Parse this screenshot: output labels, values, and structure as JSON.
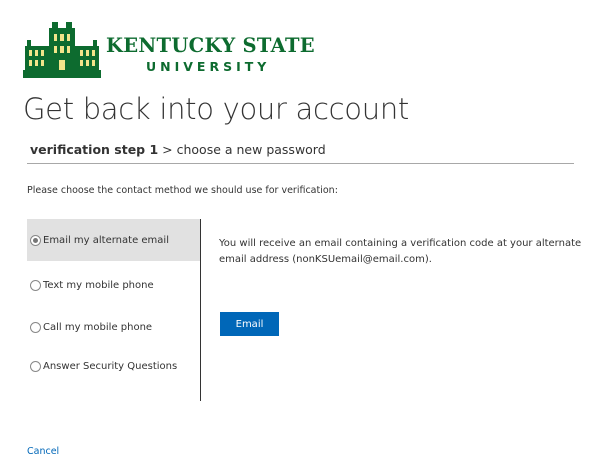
{
  "logo": {
    "line1": "KENTUCKY STATE",
    "line2": "UNIVERSITY"
  },
  "page": {
    "title": "Get back into your account"
  },
  "steps": {
    "current": "verification step 1",
    "separator": " > ",
    "next": "choose a new password"
  },
  "instructions": "Please choose the contact method we should use for verification:",
  "methods": [
    {
      "label": "Email my alternate email",
      "selected": true
    },
    {
      "label": "Text my mobile phone",
      "selected": false
    },
    {
      "label": "Call my mobile phone",
      "selected": false
    },
    {
      "label": "Answer Security Questions",
      "selected": false
    }
  ],
  "detail": {
    "text": "You will receive an email containing a verification code at your alternate email address (nonKSUemail@email.com).",
    "button_label": "Email"
  },
  "cancel_label": "Cancel",
  "colors": {
    "brand_green": "#0d6b2f",
    "button_blue": "#0067b8",
    "selected_bg": "#e1e1e1"
  },
  "icons": {
    "logo": "university-building-icon",
    "radio": "radio-button-icon"
  }
}
